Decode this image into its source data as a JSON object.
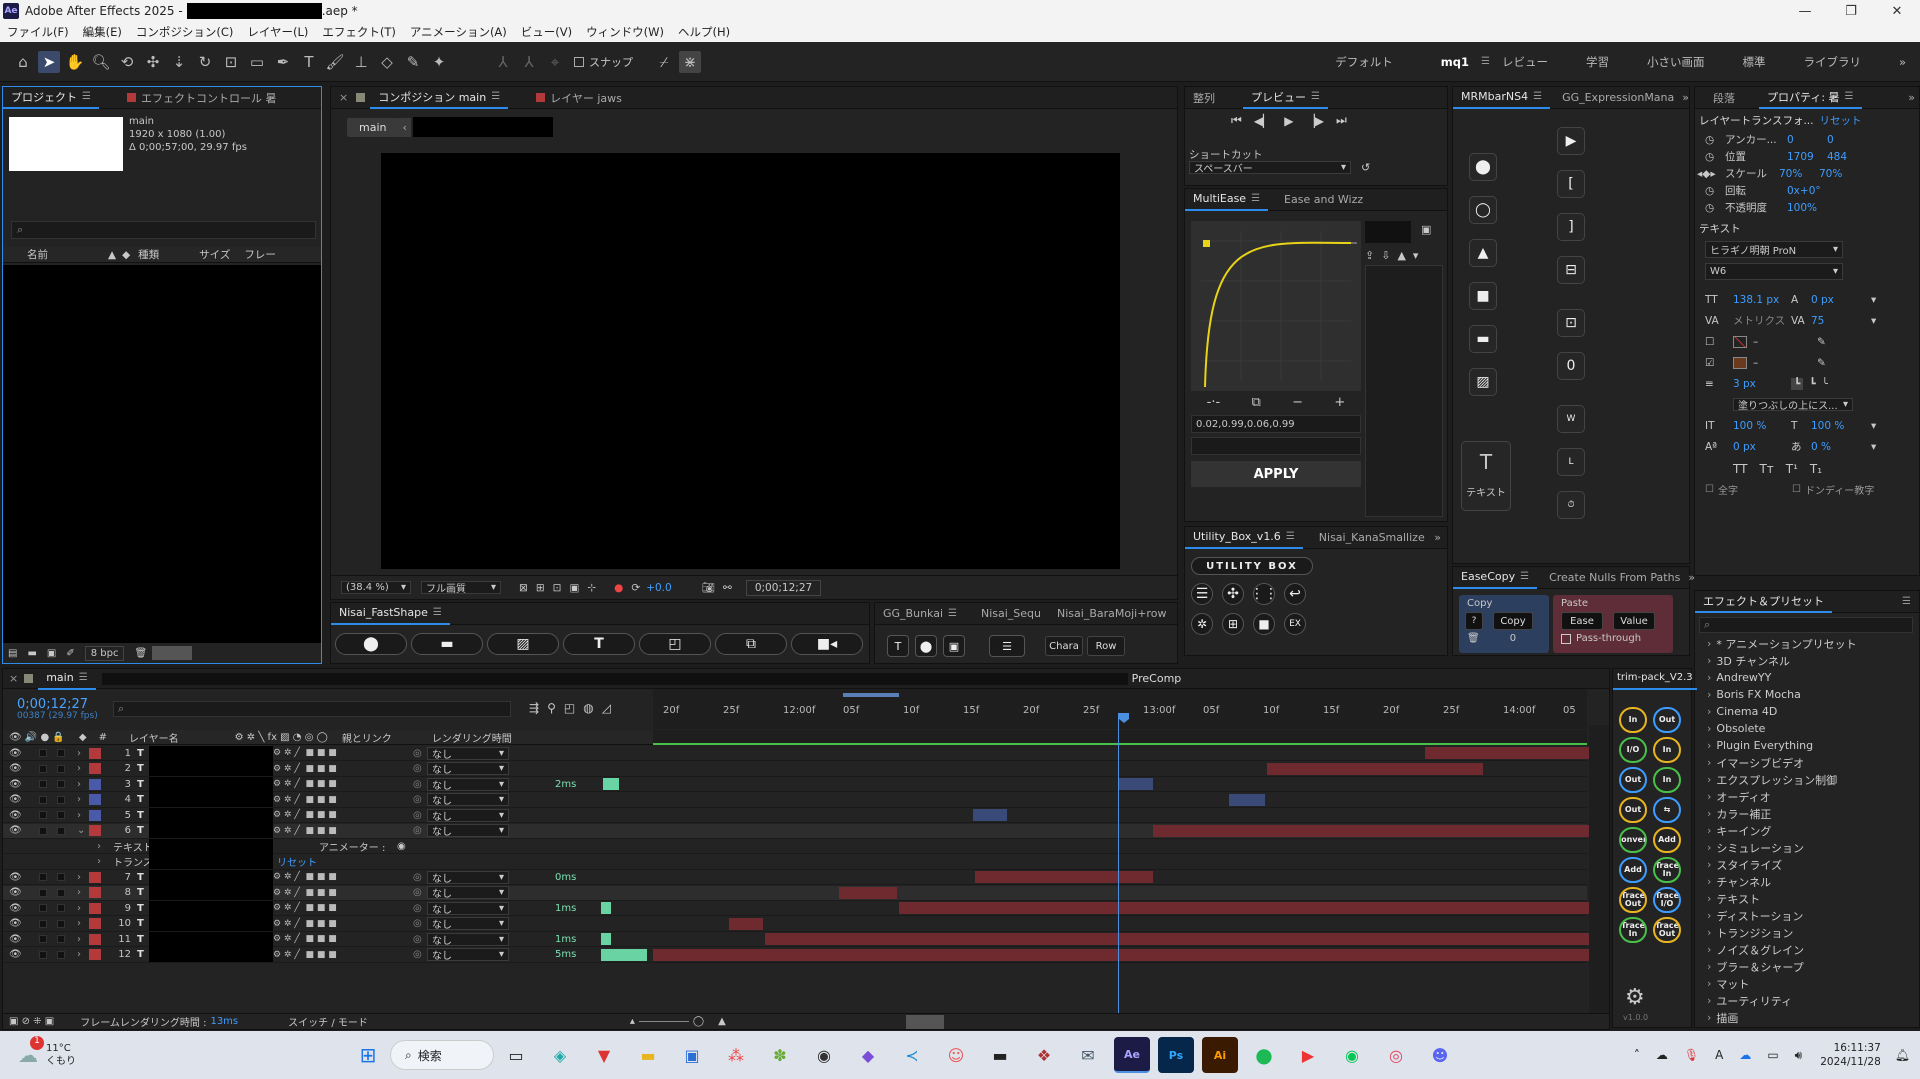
{
  "titlebar": {
    "app": "Adobe After Effects 2025 -",
    "file_suffix": ".aep *"
  },
  "menu": [
    "ファイル(F)",
    "編集(E)",
    "コンポジション(C)",
    "レイヤー(L)",
    "エフェクト(T)",
    "アニメーション(A)",
    "ビュー(V)",
    "ウィンドウ(W)",
    "ヘルプ(H)"
  ],
  "toolbar": {
    "snap": "スナップ",
    "workspaces": [
      "デフォルト",
      "mq1",
      "レビュー",
      "学習",
      "小さい画面",
      "標準",
      "ライブラリ"
    ],
    "active_ws": "mq1"
  },
  "project": {
    "tabs": [
      "プロジェクト",
      "エフェクトコントロール 暑"
    ],
    "comp_name": "main",
    "comp_dims": "1920 x 1080 (1.00)",
    "comp_dur": "Δ 0;00;57;00, 29.97 fps",
    "cols": [
      "名前",
      "種類",
      "サイズ",
      "フレー"
    ],
    "bpc": "8 bpc"
  },
  "comp": {
    "tabs": [
      "コンポジション main",
      "レイヤー jaws"
    ],
    "crumb": "main",
    "zoom": "(38.4 %)",
    "quality": "フル画質",
    "exposure": "+0.0",
    "time": "0;00;12;27"
  },
  "preview": {
    "tabs": [
      "整列",
      "プレビュー"
    ],
    "shortcut_label": "ショートカット",
    "shortcut_value": "スペースバー"
  },
  "multiease": {
    "tabs": [
      "MultiEase",
      "Ease and Wizz"
    ],
    "value": "0.02,0.99,0.06,0.99",
    "apply": "APPLY"
  },
  "utility": {
    "tabs": [
      "Utility_Box_v1.6",
      "Nisai_KanaSmallize"
    ],
    "logo": "UTILITY BOX"
  },
  "mrm": {
    "tabs": [
      "MRMbarNS4",
      "GG_ExpressionMana"
    ],
    "text_label": "テキスト"
  },
  "easecopy": {
    "tabs": [
      "EaseCopy",
      "Create Nulls From Paths"
    ],
    "copy_title": "Copy",
    "copy_btn": "Copy",
    "count": "0",
    "paste_title": "Paste",
    "ease_btn": "Ease",
    "value_btn": "Value",
    "passthrough": "Pass-through",
    "q": "?"
  },
  "props": {
    "tabs": [
      "段落",
      "プロパティ: 暑"
    ],
    "transform": "レイヤートランスフォ...",
    "reset": "リセット",
    "anchor_label": "アンカー...",
    "anchor": [
      "0",
      "0"
    ],
    "pos_label": "位置",
    "pos": [
      "1709",
      "484"
    ],
    "scale_label": "スケール",
    "scale": [
      "70%",
      "70%"
    ],
    "rot_label": "回転",
    "rot": "0x+0°",
    "opa_label": "不透明度",
    "opa": "100%",
    "text_section": "テキスト",
    "font": "ヒラギノ明朝 ProN",
    "weight": "W6",
    "size": "138.1 px",
    "leading": "0 px",
    "kern": "メトリクス",
    "track": "75",
    "stroke_w": "3 px",
    "fill_mode": "塗りつぶしの上にス...",
    "vscale": "100 %",
    "hscale": "100 %",
    "baseline": "0 px",
    "tsume": "0 %",
    "glyphs": [
      "TT",
      "Tт",
      "T¹",
      "T₁"
    ],
    "all_caps": "全字",
    "ligature": "ドンディー教字"
  },
  "fastshape": {
    "tabs": [
      "Nisai_FastShape"
    ]
  },
  "bunkai": {
    "tabs": [
      "GG_Bunkai",
      "Nisai_Sequ",
      "Nisai_BaraMoji+row"
    ],
    "chara": "Chara",
    "row": "Row"
  },
  "timeline": {
    "tab": "main",
    "time": "0;00;12;27",
    "frames": "00387 (29.97 fps)",
    "precomp": "PreComp",
    "headers": [
      "#",
      "レイヤー名",
      "親とリンク",
      "レンダリング時間"
    ],
    "ruler": [
      "20f",
      "25f",
      "12:00f",
      "05f",
      "10f",
      "15f",
      "20f",
      "25f",
      "13:00f",
      "05f",
      "10f",
      "15f",
      "20f",
      "25f",
      "14:00f",
      "05"
    ],
    "layers": [
      {
        "n": "1",
        "color": "#b23a3a",
        "parent": "なし",
        "rt": ""
      },
      {
        "n": "2",
        "color": "#b23a3a",
        "parent": "なし",
        "rt": ""
      },
      {
        "n": "3",
        "color": "#4a5aa8",
        "parent": "なし",
        "rt": "2ms"
      },
      {
        "n": "4",
        "color": "#4a5aa8",
        "parent": "なし",
        "rt": ""
      },
      {
        "n": "5",
        "color": "#4a5aa8",
        "parent": "なし",
        "rt": ""
      },
      {
        "n": "6",
        "color": "#b23a3a",
        "parent": "なし",
        "rt": ""
      },
      {
        "n": "7",
        "color": "#b23a3a",
        "parent": "なし",
        "rt": "0ms"
      },
      {
        "n": "8",
        "color": "#b23a3a",
        "parent": "なし",
        "rt": ""
      },
      {
        "n": "9",
        "color": "#b23a3a",
        "parent": "なし",
        "rt": "1ms"
      },
      {
        "n": "10",
        "color": "#b23a3a",
        "parent": "なし",
        "rt": ""
      },
      {
        "n": "11",
        "color": "#b23a3a",
        "parent": "なし",
        "rt": "1ms"
      },
      {
        "n": "12",
        "color": "#b23a3a",
        "parent": "なし",
        "rt": "5ms"
      }
    ],
    "sub_text": "テキスト",
    "sub_transform": "トランス",
    "animator": "アニメーター :",
    "reset": "リセット",
    "footer_render": "フレームレンダリング時間 :",
    "footer_ms": "13ms",
    "footer_switch": "スイッチ / モード"
  },
  "trim": {
    "tab": "trim-pack_V2.3",
    "buttons": [
      "In",
      "Out",
      "I/O",
      "In",
      "Out",
      "In",
      "Out",
      "⇆",
      "Convert",
      "Add",
      "Add",
      "Trace In",
      "Trace Out",
      "Trace I/O",
      "Trace In",
      "Trace Out"
    ],
    "ver": "v1.0.0"
  },
  "effects": {
    "tab": "エフェクト＆プリセット",
    "items": [
      "* アニメーションプリセット",
      "3D チャンネル",
      "AndrewYY",
      "Boris FX Mocha",
      "Cinema 4D",
      "Obsolete",
      "Plugin Everything",
      "イマーシブビデオ",
      "エクスプレッション制御",
      "オーディオ",
      "カラー補正",
      "キーイング",
      "シミュレーション",
      "スタイライズ",
      "チャンネル",
      "テキスト",
      "ディストーション",
      "トランジション",
      "ノイズ＆グレイン",
      "ブラー＆シャープ",
      "マット",
      "ユーティリティ",
      "描画"
    ]
  },
  "taskbar": {
    "temp": "11°C",
    "weather": "くもり",
    "badge": "1",
    "search": "検索",
    "time": "16:11:37",
    "date": "2024/11/28"
  }
}
